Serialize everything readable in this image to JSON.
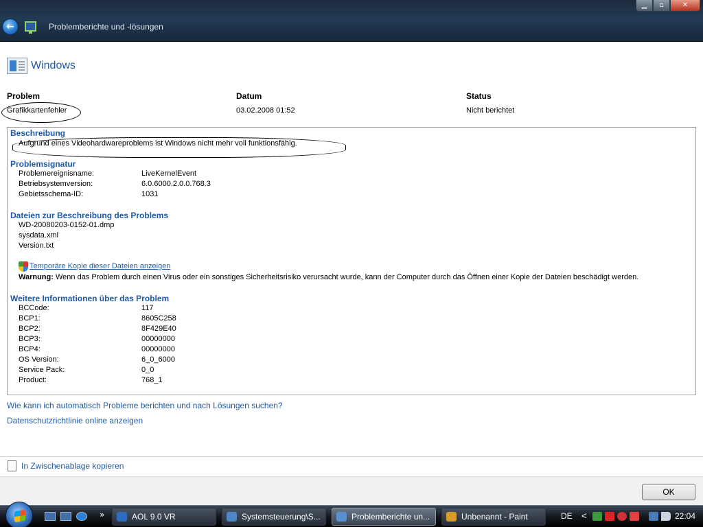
{
  "window": {
    "title": "Problemberichte und -lösungen",
    "back_glyph": "←",
    "min_glyph": "▁",
    "max_glyph": "▫",
    "close_glyph": "✕"
  },
  "header": {
    "app_name": "Windows"
  },
  "problem_table": {
    "headers": {
      "problem": "Problem",
      "date": "Datum",
      "status": "Status"
    },
    "values": {
      "problem": "Grafikkartenfehler",
      "date": "03.02.2008 01:52",
      "status": "Nicht berichtet"
    }
  },
  "details": {
    "description": {
      "heading": "Beschreibung",
      "text": "Aufgrund eines Videohardwareproblems ist Windows nicht mehr voll funktionsfähig."
    },
    "signature": {
      "heading": "Problemsignatur",
      "rows": [
        {
          "key": "Problemereignisname:",
          "value": "LiveKernelEvent"
        },
        {
          "key": "Betriebsystemversion:",
          "value": "6.0.6000.2.0.0.768.3"
        },
        {
          "key": "Gebietsschema-ID:",
          "value": "1031"
        }
      ]
    },
    "files": {
      "heading": "Dateien zur Beschreibung des Problems",
      "items": [
        "WD-20080203-0152-01.dmp",
        "sysdata.xml",
        "Version.txt"
      ],
      "temp_copy_link": "Temporäre Kopie dieser Dateien anzeigen",
      "warning_label": "Warnung:",
      "warning_text": " Wenn das Problem durch einen Virus oder ein sonstiges Sicherheitsrisiko verursacht wurde, kann der Computer durch das Öffnen einer Kopie der Dateien beschädigt werden."
    },
    "more_info": {
      "heading": "Weitere Informationen über das Problem",
      "rows": [
        {
          "key": "BCCode:",
          "value": "117"
        },
        {
          "key": "BCP1:",
          "value": "8605C258"
        },
        {
          "key": "BCP2:",
          "value": "8F429E40"
        },
        {
          "key": "BCP3:",
          "value": "00000000"
        },
        {
          "key": "BCP4:",
          "value": "00000000"
        },
        {
          "key": "OS Version:",
          "value": "6_0_6000"
        },
        {
          "key": "Service Pack:",
          "value": "0_0"
        },
        {
          "key": "Product:",
          "value": "768_1"
        }
      ]
    }
  },
  "links": {
    "auto_report": "Wie kann ich automatisch Probleme berichten und nach Lösungen suchen?",
    "privacy": "Datenschutzrichtlinie online anzeigen",
    "copy_clipboard": "In Zwischenablage kopieren"
  },
  "footer": {
    "ok_label": "OK"
  },
  "taskbar": {
    "more_glyph": "»",
    "items": [
      {
        "label": "AOL 9.0 VR",
        "icon_color": "#2d6cc0",
        "active": false
      },
      {
        "label": "Systemsteuerung\\S...",
        "icon_color": "#4f86c8",
        "active": false
      },
      {
        "label": "Problemberichte un...",
        "icon_color": "#5a8fd0",
        "active": true
      },
      {
        "label": "Unbenannt - Paint",
        "icon_color": "#d89b2a",
        "active": false
      }
    ],
    "tray": {
      "language": "DE",
      "chevron": "<",
      "time": "22:04"
    }
  }
}
